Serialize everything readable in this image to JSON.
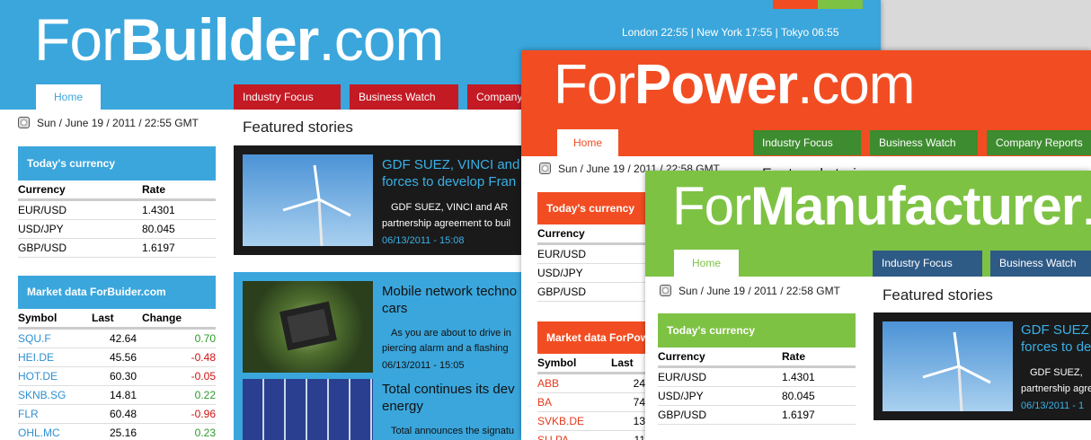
{
  "builder": {
    "logo_light": "For",
    "logo_bold": "Builder",
    "logo_tld": ".com",
    "time_zones": "London 22:55 | New York 17:55 | Tokyo 06:55",
    "home_tab": "Home",
    "nav": [
      "Industry Focus",
      "Business Watch",
      "Company"
    ],
    "date": "Sun / June 19 / 2011 / 22:55 GMT",
    "currency": {
      "title": "Today's currency",
      "headers": [
        "Currency",
        "Rate"
      ],
      "rows": [
        [
          "EUR/USD",
          "1.4301"
        ],
        [
          "USD/JPY",
          "80.045"
        ],
        [
          "GBP/USD",
          "1.6197"
        ]
      ]
    },
    "market": {
      "title": "Market data ForBuider.com",
      "headers": [
        "Symbol",
        "Last",
        "Change"
      ],
      "rows": [
        [
          "SQU.F",
          "42.64",
          "0.70"
        ],
        [
          "HEI.DE",
          "45.56",
          "-0.48"
        ],
        [
          "HOT.DE",
          "60.30",
          "-0.05"
        ],
        [
          "SKNB.SG",
          "14.81",
          "0.22"
        ],
        [
          "FLR",
          "60.48",
          "-0.96"
        ],
        [
          "OHL.MC",
          "25.16",
          "0.23"
        ]
      ]
    },
    "featured": "Featured stories",
    "story1": {
      "headline1": "GDF SUEZ, VINCI and",
      "headline2": "forces to develop Fran",
      "text1": "GDF SUEZ, VINCI and AR",
      "text2": "partnership agreement to buil",
      "date": "06/13/2011 - 15:08"
    },
    "story2": {
      "headline1": "Mobile network techno",
      "headline2": "cars",
      "text1": "As you are about to drive in",
      "text2": "piercing alarm and a flashing",
      "date": "06/13/2011 - 15:05"
    },
    "story3": {
      "headline1": "Total continues its dev",
      "headline2": "energy",
      "text1": "Total announces the signatu"
    }
  },
  "power": {
    "logo_light": "For",
    "logo_bold": "Power",
    "logo_tld": ".com",
    "home_tab": "Home",
    "nav": [
      "Industry Focus",
      "Business Watch",
      "Company Reports"
    ],
    "date": "Sun / June 19 / 2011 / 22:58 GMT",
    "featured": "Featured stories",
    "currency": {
      "title": "Today's currency",
      "headers": [
        "Currency"
      ],
      "rows": [
        "EUR/USD",
        "USD/JPY",
        "GBP/USD"
      ]
    },
    "market": {
      "title": "Market data ForPow",
      "headers": [
        "Symbol",
        "Last"
      ],
      "rows": [
        [
          "ABB",
          "24"
        ],
        [
          "BA",
          "74"
        ],
        [
          "SVKB.DE",
          "13"
        ],
        [
          "SU.PA",
          "11"
        ]
      ]
    }
  },
  "manufacturer": {
    "logo_light": "For",
    "logo_bold": "Manufacturer",
    "logo_tld": ".",
    "home_tab": "Home",
    "nav": [
      "Industry Focus",
      "Business Watch"
    ],
    "date": "Sun / June 19 / 2011 / 22:58 GMT",
    "featured": "Featured stories",
    "currency": {
      "title": "Today's currency",
      "headers": [
        "Currency",
        "Rate"
      ],
      "rows": [
        [
          "EUR/USD",
          "1.4301"
        ],
        [
          "USD/JPY",
          "80.045"
        ],
        [
          "GBP/USD",
          "1.6197"
        ]
      ]
    },
    "story1": {
      "headline1": "GDF SUEZ",
      "headline2": "forces to de",
      "text1": "GDF SUEZ,",
      "text2": "partnership agre",
      "date": "06/13/2011 - 1"
    }
  },
  "colors": {
    "builder": "#3aa6dc",
    "builder_nav": "#c41a24",
    "power": "#f24d22",
    "power_nav": "#3d8c2f",
    "manufacturer": "#7ec244",
    "manufacturer_nav": "#2e5a86"
  }
}
